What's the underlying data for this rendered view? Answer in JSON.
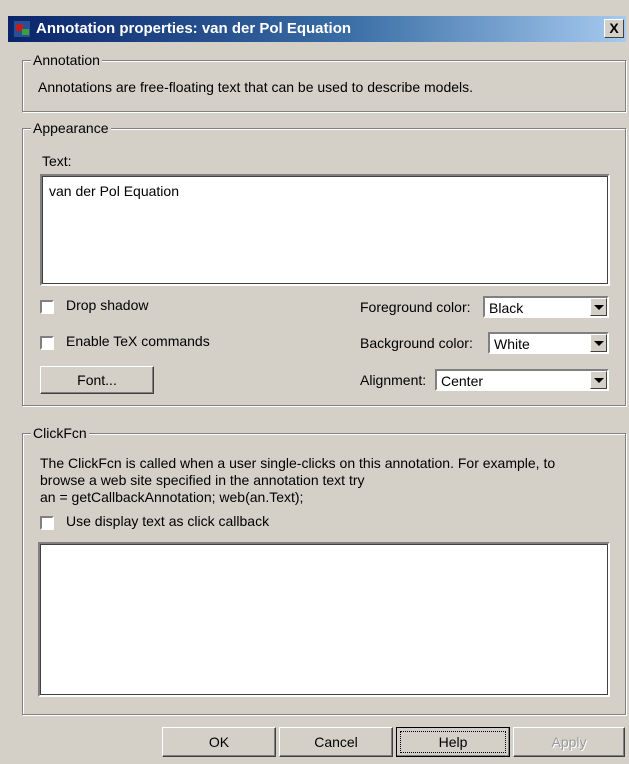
{
  "window": {
    "title": "Annotation properties: van der Pol Equation",
    "close_label": "X"
  },
  "annotation": {
    "legend": "Annotation",
    "description": "Annotations are free-floating text that can be used to describe models."
  },
  "appearance": {
    "legend": "Appearance",
    "text_label": "Text:",
    "text_value": "van der Pol Equation",
    "drop_shadow_label": "Drop shadow",
    "drop_shadow_checked": false,
    "tex_label": "Enable TeX commands",
    "tex_checked": false,
    "font_button": "Font...",
    "foreground_label": "Foreground color:",
    "foreground_value": "Black",
    "background_label": "Background color:",
    "background_value": "White",
    "alignment_label": "Alignment:",
    "alignment_value": "Center"
  },
  "clickfcn": {
    "legend": "ClickFcn",
    "description_line1": "The ClickFcn is called when a user single-clicks on this annotation. For example, to",
    "description_line2": "browse a web site specified in the annotation text try",
    "description_line3": "an = getCallbackAnnotation; web(an.Text);",
    "use_display_label": "Use display text as click callback",
    "use_display_checked": false,
    "callback_text": ""
  },
  "buttons": {
    "ok": "OK",
    "cancel": "Cancel",
    "help": "Help",
    "apply": "Apply"
  }
}
